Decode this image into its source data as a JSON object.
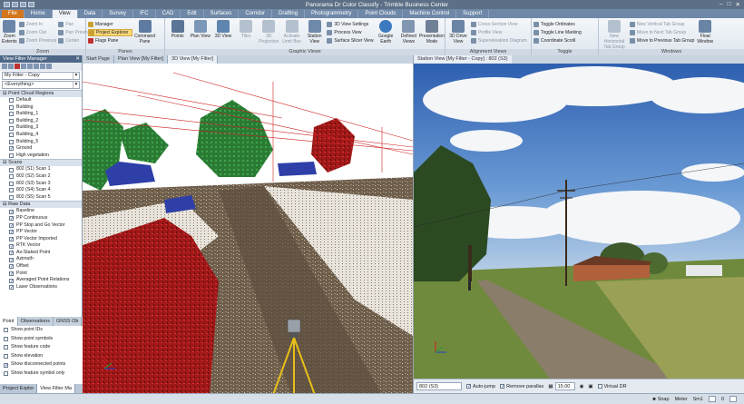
{
  "window": {
    "title": "Panorama Dr Color Classify - Trimble Business Center",
    "min": "–",
    "max": "□",
    "close": "✕"
  },
  "ribbon_tabs": [
    "File",
    "Home",
    "View",
    "Data",
    "Survey",
    "IFC",
    "CAD",
    "Edit",
    "Surfaces",
    "Corridor",
    "Drafting",
    "Photogrammetry",
    "Point Clouds",
    "Machine Control",
    "Support"
  ],
  "ribbon": {
    "zoom": {
      "label": "Zoom",
      "extents": "Zoom Extents",
      "small": [
        "Zoom In",
        "Zoom Out",
        "Zoom Previous",
        "Pan",
        "Pan Previous",
        "Center"
      ]
    },
    "panes": {
      "label": "Panes",
      "manager": "Manager",
      "project_explorer": "Project Explorer",
      "flags_pane": "Flags Pane",
      "command_pane": "Command Pane"
    },
    "graphic": {
      "label": "Graphic Views",
      "points": "Points",
      "plan": "Plan View",
      "view3d": "3D View",
      "tiles": "Tiles",
      "projection": "3D Projection",
      "activate": "Activate Limit Box",
      "station": "Station View",
      "small": [
        "3D View Settings",
        "Process View",
        "Surface Slicer View"
      ],
      "google": "Google Earth",
      "defined": "Defined Views",
      "presentation": "Presentation Mode"
    },
    "alignment": {
      "label": "Alignment Views",
      "drive": "3D Drive View",
      "small": [
        "Cross-Section View",
        "Profile View",
        "Superelevation Diagram"
      ]
    },
    "toggle": {
      "label": "Toggle",
      "small": [
        "Toggle Ordinates",
        "Toggle Line Marking",
        "Coordinate Scroll"
      ]
    },
    "windows": {
      "label": "Windows",
      "new_horizontal": "New Horizontal Tab Group",
      "small": [
        "New Vertical Tab Group",
        "Move to Next Tab Group",
        "Move to Previous Tab Group"
      ],
      "float": "Float Window"
    }
  },
  "panel": {
    "title": "View Filter Manager",
    "filter_select": "My Filter - Copy",
    "everything": "<Everything>",
    "sections": {
      "point_cloud": "Point Cloud Regions",
      "scans": "Scans",
      "raw": "Raw Data"
    },
    "point_cloud_items": [
      {
        "label": "Default",
        "checked": false
      },
      {
        "label": "Building",
        "checked": false
      },
      {
        "label": "Building_1",
        "checked": false
      },
      {
        "label": "Building_2",
        "checked": false
      },
      {
        "label": "Building_3",
        "checked": false
      },
      {
        "label": "Building_4",
        "checked": false
      },
      {
        "label": "Building_5",
        "checked": false
      },
      {
        "label": "Ground",
        "checked": true
      },
      {
        "label": "High vegetation",
        "checked": false
      }
    ],
    "scan_items": [
      {
        "label": "802 (S1) Scan 1",
        "checked": false
      },
      {
        "label": "802 (S2) Scan 2",
        "checked": false
      },
      {
        "label": "802 (S3) Scan 3",
        "checked": false
      },
      {
        "label": "802 (S4) Scan 4",
        "checked": false
      },
      {
        "label": "802 (S5) Scan 5",
        "checked": false
      }
    ],
    "raw_items": [
      {
        "label": "Baseline",
        "checked": true
      },
      {
        "label": "PP Continuous",
        "checked": true
      },
      {
        "label": "PP Stop and Go Vector",
        "checked": true
      },
      {
        "label": "PP Vector",
        "checked": true
      },
      {
        "label": "PP Vector Imported",
        "checked": true
      },
      {
        "label": "RTK Vector",
        "checked": true
      },
      {
        "label": "As-Staked Point",
        "checked": true
      },
      {
        "label": "Azimuth",
        "checked": true
      },
      {
        "label": "Offset",
        "checked": true
      },
      {
        "label": "Point",
        "checked": true
      },
      {
        "label": "Averaged Point Relations",
        "checked": true
      },
      {
        "label": "Laser Observations",
        "checked": true
      }
    ],
    "sub_tabs": [
      "Point",
      "Observations",
      "GNSS Ob"
    ],
    "point_options": [
      {
        "label": "Show point IDs",
        "checked": false
      },
      {
        "label": "Show point symbols",
        "checked": false
      },
      {
        "label": "Show feature code",
        "checked": false
      },
      {
        "label": "Show elevation",
        "checked": false
      },
      {
        "label": "Show disconnected points",
        "checked": true
      },
      {
        "label": "Show feature symbol only",
        "checked": false
      }
    ],
    "bottom_tabs": [
      "Project Explor",
      "View Filter Ma"
    ]
  },
  "view1_tabs": [
    "Start Page",
    "Plan View [My Filter]",
    "3D View [My Filter]"
  ],
  "view2_tab": "Station View [My Filter - Copy] : 802 (S3)",
  "station_bar": {
    "station": "802 (S3)",
    "auto_jump": "Auto-jump",
    "auto_jump_checked": true,
    "remove_parallax": "Remove parallax",
    "remove_parallax_checked": true,
    "value": "15.00",
    "virtual_dr": "Virtual DR",
    "virtual_dr_checked": false
  },
  "status": {
    "snap": "Snap",
    "meter": "Meter",
    "sm": "Sm1",
    "page": "0"
  },
  "colors": {
    "accent": "#d4761e",
    "ground": "#7a6a55",
    "building": "#2f3fa8",
    "vegetation": "#2e8a3a",
    "wires": "#cc2222"
  }
}
